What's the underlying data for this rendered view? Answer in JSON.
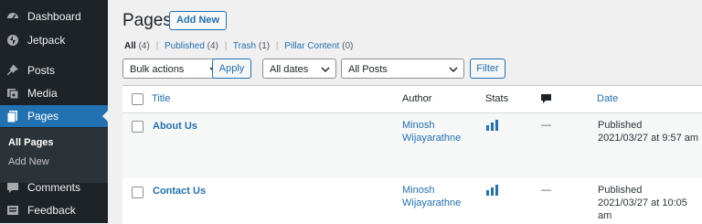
{
  "sidebar": {
    "items": [
      {
        "label": "Dashboard",
        "icon": "dashboard-icon"
      },
      {
        "label": "Jetpack",
        "icon": "jetpack-icon"
      },
      {
        "label": "Posts",
        "icon": "pin-icon"
      },
      {
        "label": "Media",
        "icon": "media-icon"
      },
      {
        "label": "Pages",
        "icon": "pages-icon"
      },
      {
        "label": "Comments",
        "icon": "comments-icon"
      },
      {
        "label": "Feedback",
        "icon": "feedback-icon"
      }
    ],
    "submenu": [
      "All Pages",
      "Add New"
    ]
  },
  "header": {
    "title": "Pages",
    "add_new": "Add New"
  },
  "filters": {
    "all": "All",
    "all_count": "(4)",
    "published": "Published",
    "published_count": "(4)",
    "trash": "Trash",
    "trash_count": "(1)",
    "pillar": "Pillar Content",
    "pillar_count": "(0)",
    "sep": "|"
  },
  "toolbar": {
    "bulk": "Bulk actions",
    "apply": "Apply",
    "dates": "All dates",
    "posts": "All Posts",
    "filter": "Filter"
  },
  "table": {
    "columns": {
      "title": "Title",
      "author": "Author",
      "stats": "Stats",
      "date": "Date"
    },
    "rows": [
      {
        "title": "About Us",
        "author_1": "Minosh",
        "author_2": "Wijayarathne",
        "comments": "—",
        "status": "Published",
        "date": "2021/03/27 at 9:57 am"
      },
      {
        "title": "Contact Us",
        "author_1": "Minosh",
        "author_2": "Wijayarathne",
        "comments": "—",
        "status": "Published",
        "date": "2021/03/27 at 10:05 am"
      }
    ]
  },
  "colors": {
    "accent": "#2271b1",
    "sidebar": "#1d2327",
    "active": "#2271b1"
  }
}
